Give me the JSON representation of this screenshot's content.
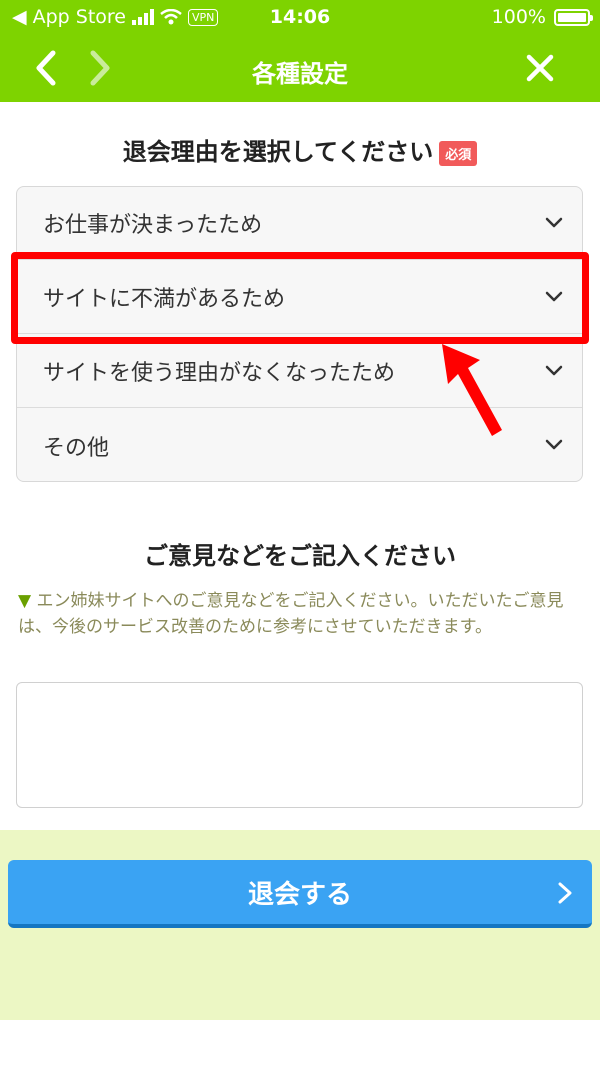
{
  "status_bar": {
    "back_app": "App Store",
    "vpn": "VPN",
    "time": "14:06",
    "battery": "100%"
  },
  "nav": {
    "title": "各種設定"
  },
  "reason_section": {
    "title": "退会理由を選択してください",
    "required_badge": "必須",
    "options": [
      "お仕事が決まったため",
      "サイトに不満があるため",
      "サイトを使う理由がなくなったため",
      "その他"
    ]
  },
  "opinion_section": {
    "title": "ご意見などをご記入ください",
    "note_marker": "▼",
    "note_text": "エン姉妹サイトへのご意見などをご記入ください。いただいたご意見は、今後のサービス改善のために参考にさせていただきます。",
    "textarea_value": ""
  },
  "submit": {
    "label": "退会する"
  },
  "colors": {
    "header_green": "#7ed300",
    "submit_blue": "#3aa3f3",
    "highlight_red": "#ff0000",
    "footer_band": "#ecf7c4"
  }
}
